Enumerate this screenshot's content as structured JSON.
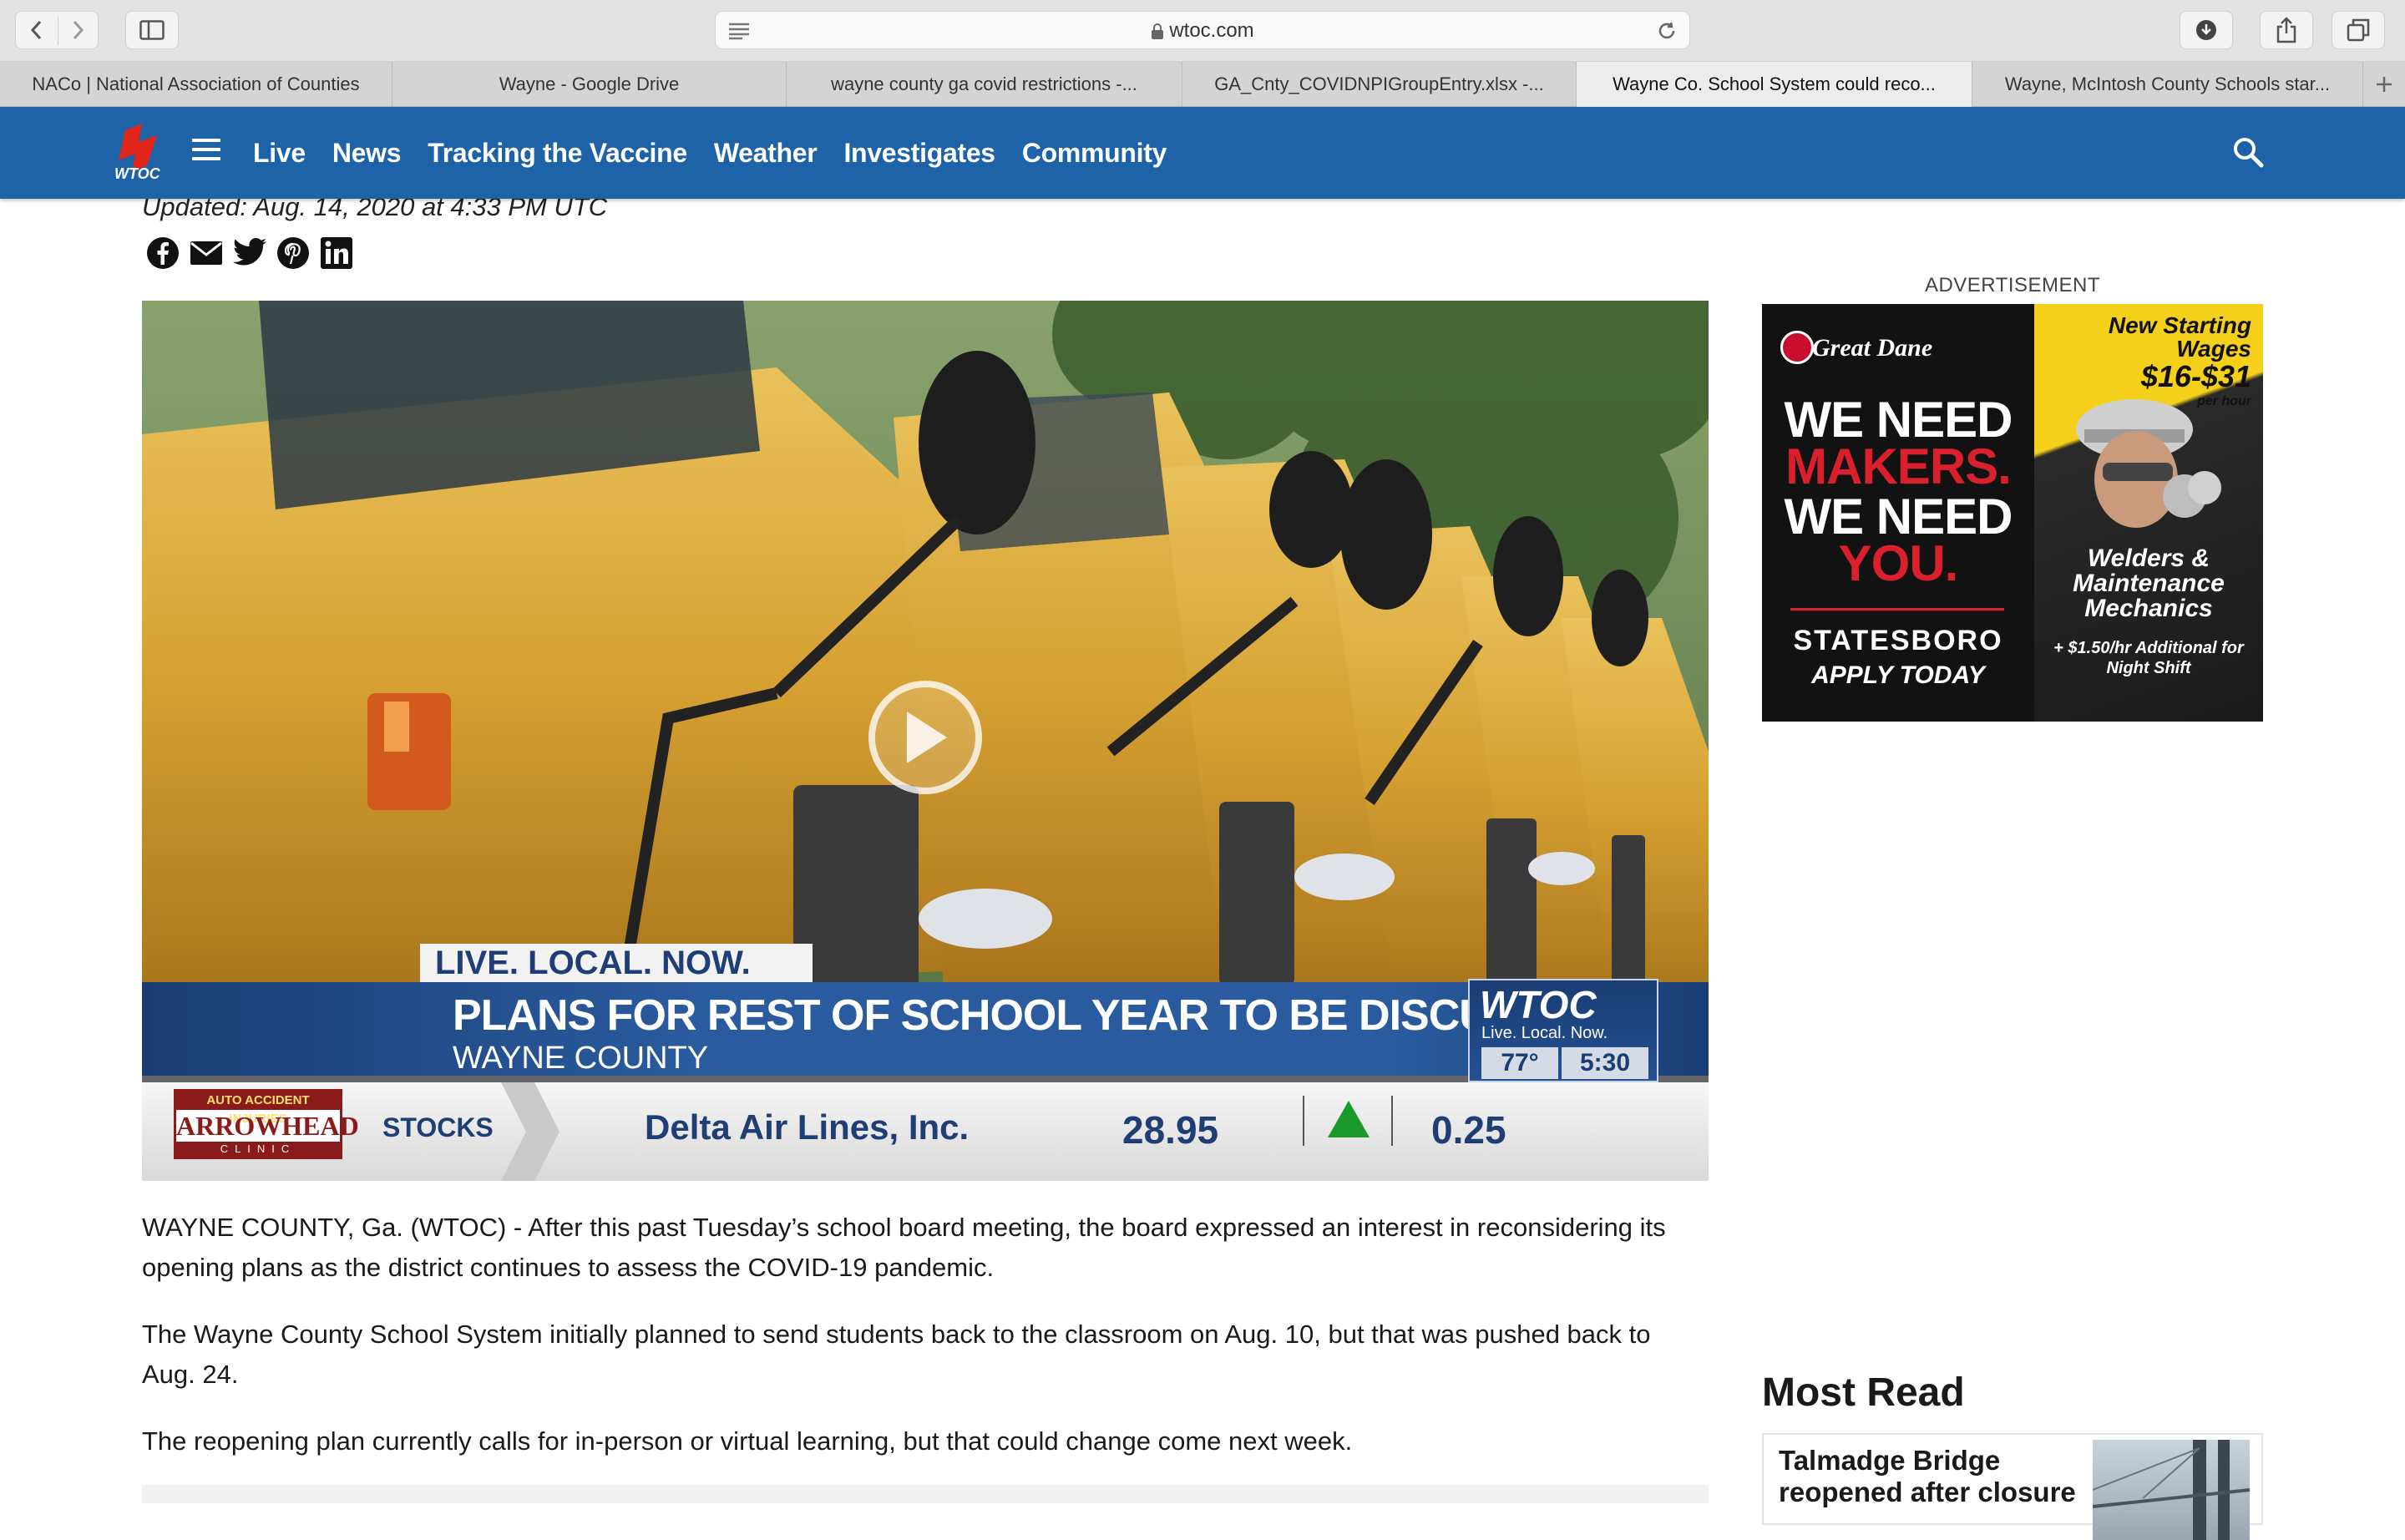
{
  "browser": {
    "url": "wtoc.com",
    "tabs": [
      {
        "label": "NACo | National Association of Counties",
        "active": false
      },
      {
        "label": "Wayne - Google Drive",
        "active": false
      },
      {
        "label": "wayne county ga covid restrictions -...",
        "active": false
      },
      {
        "label": "GA_Cnty_COVIDNPIGroupEntry.xlsx -...",
        "active": false
      },
      {
        "label": "Wayne Co. School System could reco...",
        "active": true
      },
      {
        "label": "Wayne, McIntosh County Schools star...",
        "active": false
      }
    ]
  },
  "site": {
    "logo_text": "WTOC",
    "nav": [
      "Live",
      "News",
      "Tracking the Vaccine",
      "Weather",
      "Investigates",
      "Community"
    ],
    "brand_color": "#1e63a8"
  },
  "article": {
    "updated": "Updated: Aug. 14, 2020 at 4:33 PM UTC",
    "share_icons": [
      "facebook-icon",
      "email-icon",
      "twitter-icon",
      "pinterest-icon",
      "linkedin-icon"
    ],
    "video": {
      "tag": "LIVE. LOCAL. NOW.",
      "headline": "PLANS FOR REST OF SCHOOL YEAR TO BE DISCUSSED",
      "subhead": "WAYNE COUNTY",
      "bug_name": "WTOC",
      "bug_tagline": "Live. Local. Now.",
      "temp": "77°",
      "time": "5:30",
      "sponsor_top": "AUTO ACCIDENT INJURIES",
      "sponsor_name": "ARROWHEAD",
      "sponsor_bottom": "CLINIC",
      "ticker_label": "STOCKS",
      "stock_name": "Delta Air Lines, Inc.",
      "stock_price": "28.95",
      "stock_change": "0.25"
    },
    "paragraphs": [
      "WAYNE COUNTY, Ga. (WTOC) - After this past Tuesday’s school board meeting, the board expressed an interest in reconsidering its opening plans as the district continues to assess the COVID-19 pandemic.",
      "The Wayne County School System initially planned to send students back to the classroom on Aug. 10, but that was pushed back to Aug. 24.",
      "The reopening plan currently calls for in-person or virtual learning, but that could change come next week."
    ]
  },
  "sidebar": {
    "ad_label": "ADVERTISEMENT",
    "ad": {
      "brand": "Great Dane",
      "line1": "WE NEED",
      "line2": "MAKERS.",
      "line3": "WE NEED",
      "line4": "YOU.",
      "city": "STATESBORO",
      "cta": "APPLY TODAY",
      "headline": "New Starting Wages",
      "wage": "$16-$31",
      "per": "per hour",
      "roles": "Welders & Maintenance Mechanics",
      "bonus": "+ $1.50/hr Additional for Night Shift"
    },
    "most_read_title": "Most Read",
    "most_read": [
      {
        "title": "Talmadge Bridge reopened after closure"
      }
    ]
  }
}
